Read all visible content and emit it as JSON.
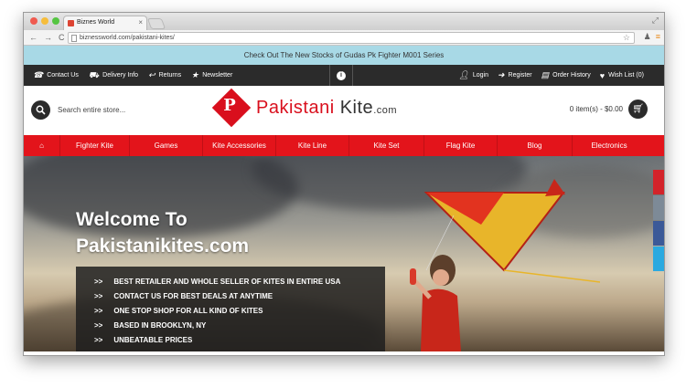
{
  "browser": {
    "tab_title": "Biznes World",
    "tab_close": "×",
    "url": "biznessworld.com/pakistani-kites/",
    "nav": [
      "←",
      "→",
      "C"
    ],
    "resize": "⤢"
  },
  "announcement": "Check Out The New Stocks of Gudas Pk Fighter M001 Series",
  "topbar": {
    "left": [
      "Contact Us",
      "Delivery Info",
      "Returns",
      "Newsletter"
    ],
    "right": [
      "Login",
      "Register",
      "Order History",
      "Wish List (0)"
    ],
    "info": "i"
  },
  "header": {
    "search_placeholder": "Search entire store...",
    "logo_letter": "P",
    "logo_red": "Pakistani",
    "logo_dark": "Kite",
    "logo_suffix": ".com",
    "cart": "0 item(s) - $0.00"
  },
  "menu": [
    "Fighter Kite",
    "Games",
    "Kite Accessories",
    "Kite Line",
    "Kite Set",
    "Flag Kite",
    "Blog",
    "Electronics"
  ],
  "hero": {
    "title_line1": "Welcome To",
    "title_line2": "Pakistanikites.com",
    "bullets": [
      "BEST RETAILER AND WHOLE SELLER OF KITES IN ENTIRE USA",
      "CONTACT US FOR BEST DEALS AT ANYTIME",
      "ONE STOP SHOP FOR ALL KIND OF KITES",
      "BASED IN BROOKLYN, NY",
      "UNBEATABLE PRICES"
    ],
    "bullet_marker": ">>"
  },
  "colors": {
    "brand_red": "#e3141b",
    "announce_bg": "#a8d9e6",
    "topbar_bg": "#2b2b2b"
  }
}
